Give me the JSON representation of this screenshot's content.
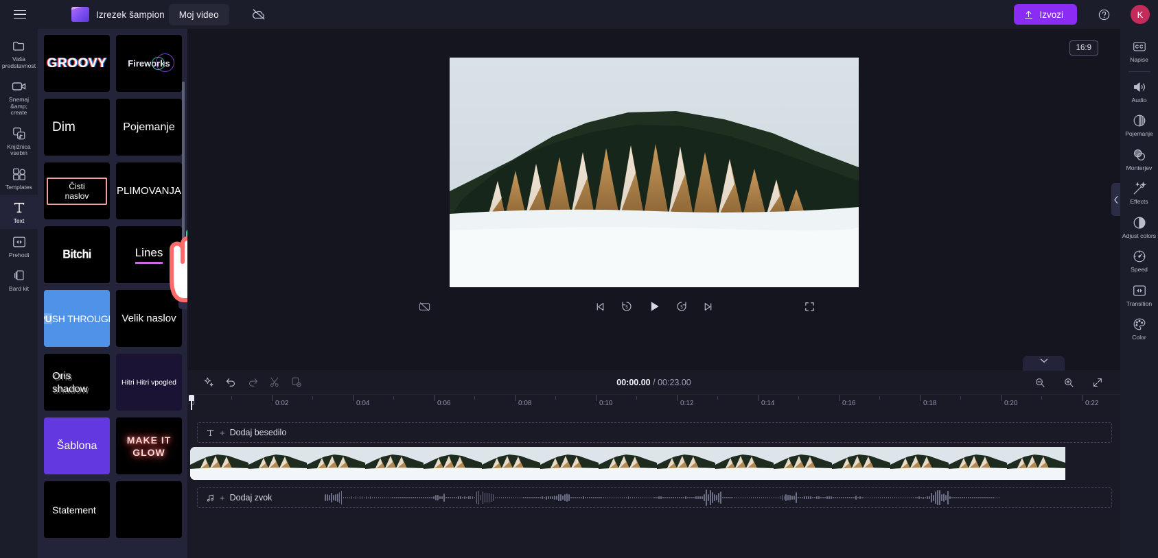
{
  "app": {
    "menu_icon": "hamburger-icon",
    "logo_icon": "clipchamp-logo-icon",
    "project_label": "Izrezek šampion",
    "project_title": "Moj video",
    "cloud_icon": "cloud-off-icon",
    "export_label": "Izvozi",
    "export_icon": "upload-icon",
    "help_icon": "help-circle-icon",
    "avatar_initial": "K",
    "accent_color": "#8b2cf5",
    "avatar_color": "#c22b5a"
  },
  "left_rail": {
    "items": [
      {
        "label": "Vaša predstavnost",
        "icon": "folder-icon",
        "active": false
      },
      {
        "label": "Snemaj &amp; create",
        "icon": "camera-icon",
        "active": false
      },
      {
        "label": "Knjižnica vsebin",
        "icon": "content-library-icon",
        "active": false
      },
      {
        "label": "Templates",
        "icon": "templates-icon",
        "active": false
      },
      {
        "label": "Text",
        "icon": "text-icon",
        "active": true
      },
      {
        "label": "Prehodi",
        "icon": "transition-icon",
        "active": false
      },
      {
        "label": "Bard kit",
        "icon": "brand-kit-icon",
        "active": false
      }
    ]
  },
  "templates_panel": {
    "collapse_icon": "chevron-left-icon",
    "add_badge_icon": "plus-icon",
    "cursor_icon": "hand-pointer-cursor",
    "cards": [
      {
        "label": "GROOVY",
        "style": "groovy"
      },
      {
        "label": "Fireworks",
        "style": "fireworks"
      },
      {
        "label": "Dim",
        "style": "plain-left"
      },
      {
        "label": "Pojemanje",
        "style": "plain"
      },
      {
        "label": "Čisti naslov",
        "style": "clean-title"
      },
      {
        "label": "PLIMOVANJA",
        "style": "plain"
      },
      {
        "label": "Bitchi",
        "style": "bitchi"
      },
      {
        "label": "Lines",
        "style": "underline"
      },
      {
        "label": "PUSH THROUGH",
        "style": "push"
      },
      {
        "label": "Velik naslov",
        "style": "plain"
      },
      {
        "label": "Oris shadow",
        "style": "shadow"
      },
      {
        "label": "Hitri Hitri vpogled",
        "style": "quick"
      },
      {
        "label": "Šablona",
        "style": "sablona"
      },
      {
        "label": "MAKE IT GLOW",
        "style": "glow"
      },
      {
        "label": "Statement",
        "style": "plain-left"
      },
      {
        "label": "",
        "style": "plain"
      }
    ]
  },
  "preview": {
    "ratio_label": "16:9",
    "left_arrow_icon": "chevron-left-icon",
    "right_arrow_icon": "chevron-left-icon",
    "controls": {
      "captions_icon": "captions-off-icon",
      "skip_back_icon": "skip-back-icon",
      "rewind_icon": "rewind-5-icon",
      "rewind_label": "5",
      "play_icon": "play-icon",
      "forward_icon": "forward-5-icon",
      "forward_label": "5",
      "skip_forward_icon": "skip-forward-icon",
      "fullscreen_icon": "fullscreen-icon"
    }
  },
  "timeline": {
    "collapse_icon": "chevron-down-icon",
    "tools": [
      {
        "name": "magic-tool",
        "icon": "sparkle-icon"
      },
      {
        "name": "undo-button",
        "icon": "undo-icon"
      },
      {
        "name": "redo-button",
        "icon": "redo-icon"
      },
      {
        "name": "split-button",
        "icon": "scissors-icon"
      },
      {
        "name": "duplicate-button",
        "icon": "duplicate-icon"
      }
    ],
    "current_time": "00:00.00",
    "time_separator": "/",
    "total_time": "00:23.00",
    "zoom_out_icon": "zoom-out-icon",
    "zoom_in_icon": "zoom-in-icon",
    "fit_icon": "fit-to-screen-icon",
    "ruler_labels": [
      "0",
      "0:02",
      "0:04",
      "0:06",
      "0:08",
      "0:10",
      "0:12",
      "0:14",
      "0:16",
      "0:18",
      "0:20",
      "0:22"
    ],
    "text_track": {
      "icon": "text-track-icon",
      "plus": "+",
      "label": "Dodaj besedilo"
    },
    "audio_track": {
      "icon": "music-note-icon",
      "plus": "+",
      "label": "Dodaj zvok"
    }
  },
  "right_rail": {
    "items": [
      {
        "label": "Napise",
        "icon": "captions-icon",
        "divider_after": true
      },
      {
        "label": "Audio",
        "icon": "speaker-icon",
        "divider_after": false
      },
      {
        "label": "Pojemanje",
        "icon": "fade-icon",
        "divider_after": false
      },
      {
        "label": "Monterjev",
        "icon": "filters-icon",
        "divider_after": false
      },
      {
        "label": "Effects",
        "icon": "magic-wand-icon",
        "divider_after": false
      },
      {
        "label": "Adjust colors",
        "icon": "contrast-icon",
        "divider_after": false
      },
      {
        "label": "Speed",
        "icon": "speedometer-icon",
        "divider_after": false
      },
      {
        "label": "Transition",
        "icon": "transition-icon",
        "divider_after": false
      },
      {
        "label": "Color",
        "icon": "palette-icon",
        "divider_after": false
      }
    ]
  }
}
